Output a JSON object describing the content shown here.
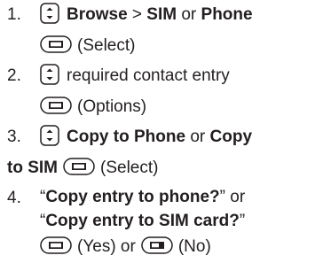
{
  "steps": [
    {
      "number": "1.",
      "line1": {
        "bold1": "Browse",
        "sep": " > ",
        "bold2": "SIM",
        "plain": " or ",
        "bold3": "Phone"
      },
      "line2": {
        "text": "(Select)"
      }
    },
    {
      "number": "2.",
      "line1": {
        "text": "required contact entry"
      },
      "line2": {
        "text": "(Options)"
      }
    },
    {
      "number": "3.",
      "line1": {
        "bold1": "Copy to Phone",
        "plain": " or ",
        "bold2": "Copy"
      },
      "line2": {
        "bold": "to SIM",
        "text": "(Select)"
      }
    },
    {
      "number": "4.",
      "line1": {
        "open_quote": "“",
        "bold": "Copy entry to phone?",
        "close_quote": "”",
        "plain": " or"
      },
      "line2": {
        "open_quote": "“",
        "bold": "Copy entry to SIM card?",
        "close_quote": "”"
      },
      "line3": {
        "yes": "(Yes) or",
        "no": "(No)"
      }
    }
  ],
  "icons": {
    "nav_key": "navigation-key-icon",
    "left_soft_key": "left-soft-key-icon",
    "right_soft_key": "right-soft-key-icon"
  },
  "colors": {
    "text": "#231f20"
  }
}
